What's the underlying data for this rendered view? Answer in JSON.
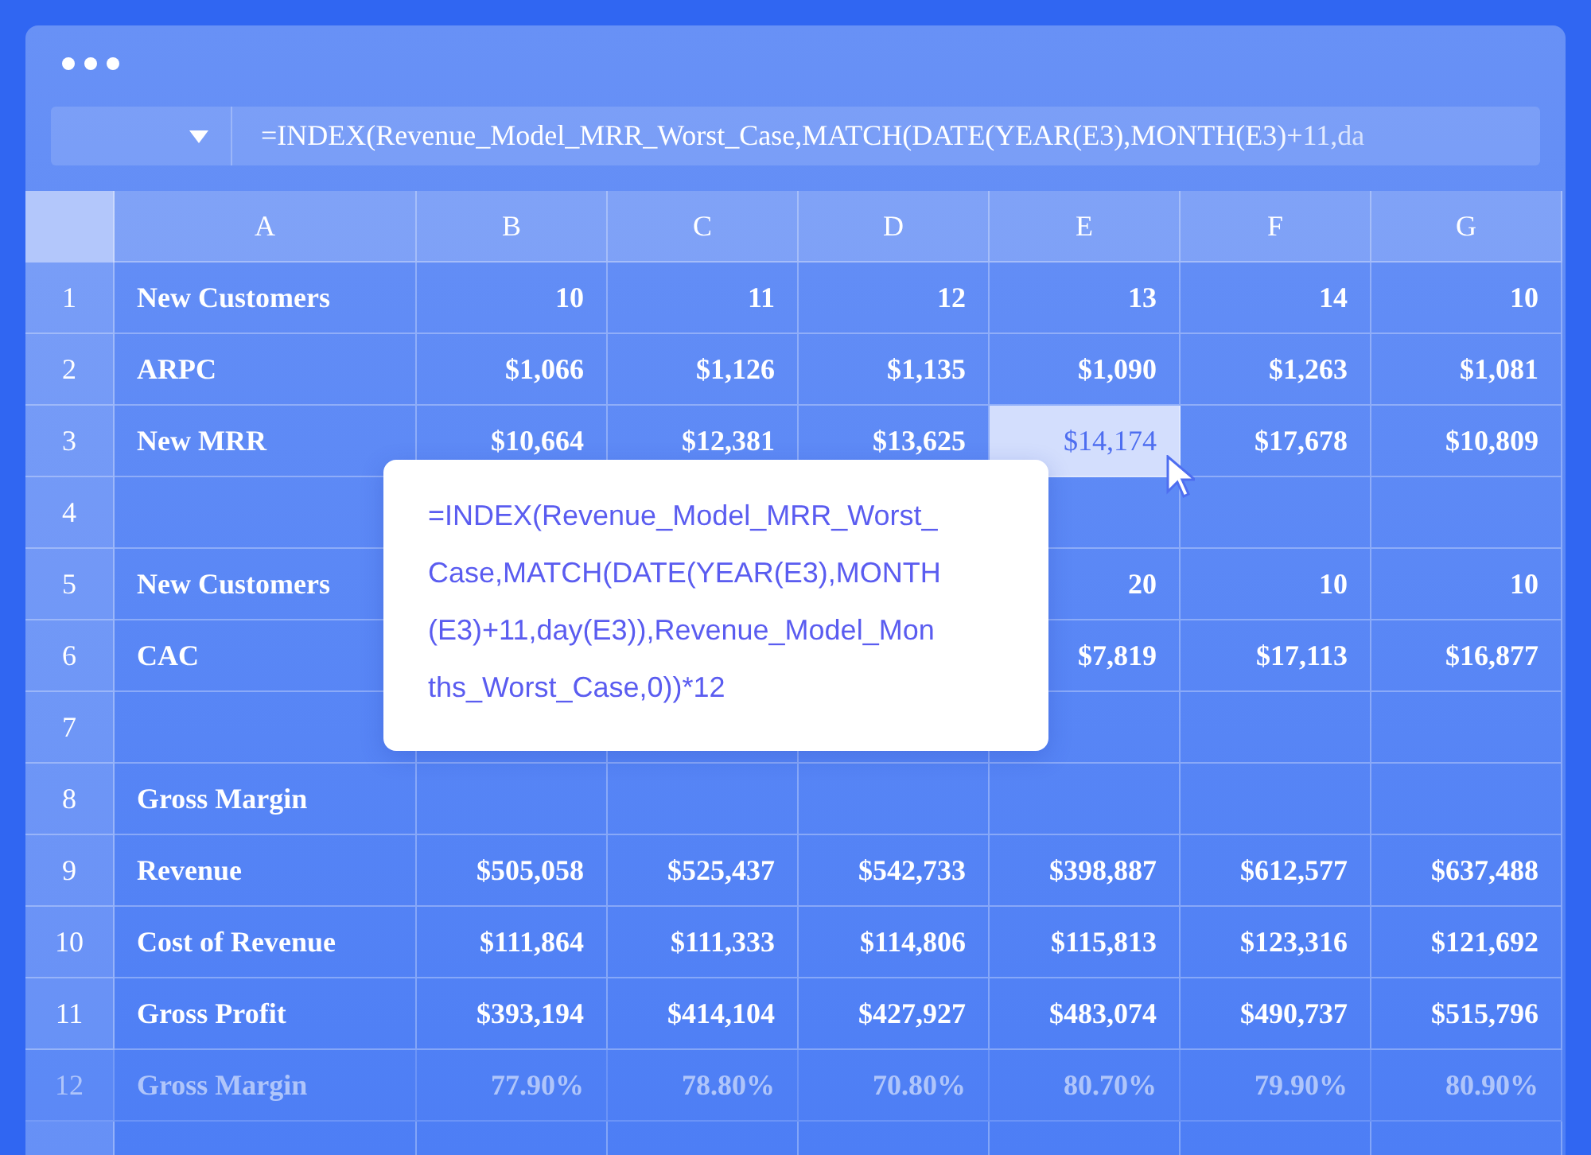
{
  "formula_bar": {
    "formula": "=INDEX(Revenue_Model_MRR_Worst_Case,MATCH(DATE(YEAR(E3),MONTH(E3)+11,da"
  },
  "columns": [
    "A",
    "B",
    "C",
    "D",
    "E",
    "F",
    "G"
  ],
  "rows": [
    {
      "number": "1",
      "label": "New Customers",
      "faded": false,
      "cells": [
        {
          "text": "10",
          "selected": false
        },
        {
          "text": "11",
          "selected": false
        },
        {
          "text": "12",
          "selected": false
        },
        {
          "text": "13",
          "selected": false
        },
        {
          "text": "14",
          "selected": false
        },
        {
          "text": "10",
          "selected": false
        }
      ]
    },
    {
      "number": "2",
      "label": "ARPC",
      "faded": false,
      "cells": [
        {
          "text": "$1,066",
          "selected": false
        },
        {
          "text": "$1,126",
          "selected": false
        },
        {
          "text": "$1,135",
          "selected": false
        },
        {
          "text": "$1,090",
          "selected": false
        },
        {
          "text": "$1,263",
          "selected": false
        },
        {
          "text": "$1,081",
          "selected": false
        }
      ]
    },
    {
      "number": "3",
      "label": "New MRR",
      "faded": false,
      "cells": [
        {
          "text": "$10,664",
          "selected": false
        },
        {
          "text": "$12,381",
          "selected": false
        },
        {
          "text": "$13,625",
          "selected": false
        },
        {
          "text": "$14,174",
          "selected": true
        },
        {
          "text": "$17,678",
          "selected": false
        },
        {
          "text": "$10,809",
          "selected": false
        }
      ]
    },
    {
      "number": "4",
      "faded": false,
      "cells": [
        null,
        null,
        null,
        {
          "selected": false
        },
        {
          "selected": false
        },
        {
          "selected": false
        }
      ]
    },
    {
      "number": "5",
      "label": "New Customers",
      "faded": false,
      "cells": [
        null,
        null,
        null,
        {
          "text": "20",
          "selected": false
        },
        {
          "text": "10",
          "selected": false
        },
        {
          "text": "10",
          "selected": false
        }
      ]
    },
    {
      "number": "6",
      "label": "CAC",
      "faded": false,
      "cells": [
        null,
        null,
        null,
        {
          "text": "$7,819",
          "selected": false
        },
        {
          "text": "$17,113",
          "selected": false
        },
        {
          "text": "$16,877",
          "selected": false
        }
      ]
    },
    {
      "number": "7",
      "faded": false,
      "cells": [
        {
          "selected": false
        },
        {
          "selected": false
        },
        {
          "selected": false
        },
        {
          "selected": false
        },
        {
          "selected": false
        },
        {
          "selected": false
        }
      ]
    },
    {
      "number": "8",
      "label": "Gross Margin",
      "faded": false,
      "cells": [
        {
          "selected": false
        },
        {
          "selected": false
        },
        {
          "selected": false
        },
        {
          "selected": false
        },
        {
          "selected": false
        },
        {
          "selected": false
        }
      ]
    },
    {
      "number": "9",
      "label": "Revenue",
      "faded": false,
      "cells": [
        {
          "text": "$505,058",
          "selected": false
        },
        {
          "text": "$525,437",
          "selected": false
        },
        {
          "text": "$542,733",
          "selected": false
        },
        {
          "text": "$398,887",
          "selected": false
        },
        {
          "text": "$612,577",
          "selected": false
        },
        {
          "text": "$637,488",
          "selected": false
        }
      ]
    },
    {
      "number": "10",
      "label": "Cost of Revenue",
      "faded": false,
      "cells": [
        {
          "text": "$111,864",
          "selected": false
        },
        {
          "text": "$111,333",
          "selected": false
        },
        {
          "text": "$114,806",
          "selected": false
        },
        {
          "text": "$115,813",
          "selected": false
        },
        {
          "text": "$123,316",
          "selected": false
        },
        {
          "text": "$121,692",
          "selected": false
        }
      ]
    },
    {
      "number": "11",
      "label": "Gross Profit",
      "faded": false,
      "cells": [
        {
          "text": "$393,194",
          "selected": false
        },
        {
          "text": "$414,104",
          "selected": false
        },
        {
          "text": "$427,927",
          "selected": false
        },
        {
          "text": "$483,074",
          "selected": false
        },
        {
          "text": "$490,737",
          "selected": false
        },
        {
          "text": "$515,796",
          "selected": false
        }
      ]
    },
    {
      "number": "12",
      "label": "Gross Margin",
      "faded": true,
      "cells": [
        {
          "text": "77.90%",
          "selected": false
        },
        {
          "text": "78.80%",
          "selected": false
        },
        {
          "text": "70.80%",
          "selected": false
        },
        {
          "text": "80.70%",
          "selected": false
        },
        {
          "text": "79.90%",
          "selected": false
        },
        {
          "text": "80.90%",
          "selected": false
        }
      ]
    }
  ],
  "formula_popup": {
    "lines": [
      "=INDEX(Revenue_Model_MRR_Worst_",
      "Case,MATCH(DATE(YEAR(E3),MONTH",
      "(E3)+11,day(E3)),Revenue_Model_Mon",
      "ths_Worst_Case,0))*12"
    ]
  }
}
